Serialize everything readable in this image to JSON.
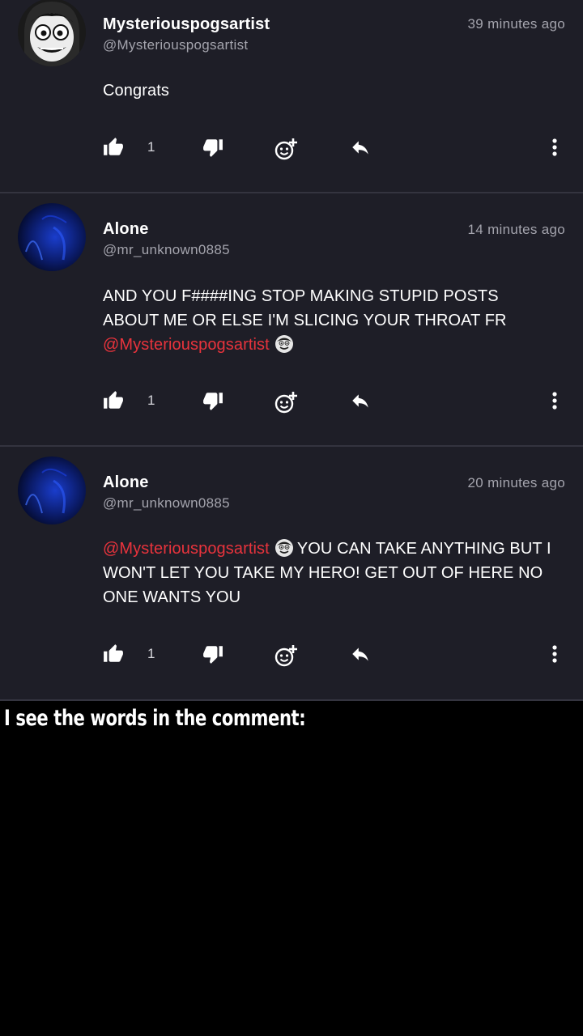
{
  "comments": [
    {
      "name": "Mysteriouspogsartist",
      "handle": "@Mysteriouspogsartist",
      "time": "39 minutes ago",
      "text": "Congrats",
      "likes": "1",
      "avatar_icon": "cartoon-face-avatar"
    },
    {
      "name": "Alone",
      "handle": "@mr_unknown0885",
      "time": "14 minutes ago",
      "text_main": "AND YOU F####ING STOP MAKING STUPID POSTS ABOUT ME OR ELSE I'M SLICING YOUR THROAT FR",
      "mention": "@Mysteriouspogsartist",
      "likes": "1",
      "avatar_icon": "dark-blue-avatar"
    },
    {
      "name": "Alone",
      "handle": "@mr_unknown0885",
      "time": "20 minutes ago",
      "mention": "@Mysteriouspogsartist",
      "text_after": "YOU CAN TAKE ANYTHING BUT I WON'T LET YOU TAKE MY HERO! GET OUT OF HERE NO ONE WANTS YOU",
      "likes": "1",
      "avatar_icon": "dark-blue-avatar"
    }
  ],
  "caption": "I see the words in the comment:",
  "colors": {
    "background": "#1e1e27",
    "mention": "#e8333c",
    "divider": "#34343f",
    "secondary_text": "#a4a4ad"
  },
  "icons": [
    "thumbs-up-icon",
    "thumbs-down-icon",
    "add-reaction-icon",
    "reply-icon",
    "more-vertical-icon",
    "face-emoji-icon"
  ]
}
